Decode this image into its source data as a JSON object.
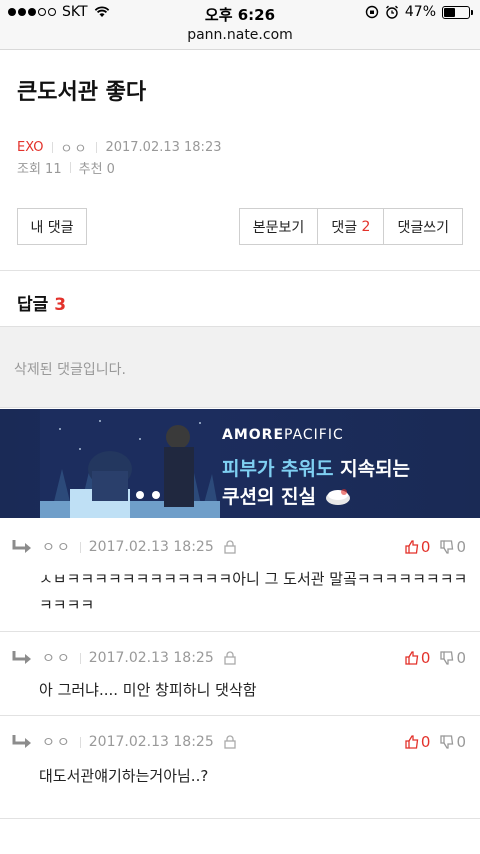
{
  "status": {
    "carrier": "SKT",
    "time": "오후 6:26",
    "battery": "47%",
    "battery_level": 0.47
  },
  "url": "pann.nate.com",
  "article": {
    "title": "큰도서관 좋다",
    "category": "EXO",
    "author": "ㅇㅇ",
    "datetime": "2017.02.13 18:23",
    "views": "조회 11",
    "recommend": "추천 0"
  },
  "buttons": {
    "my_comments": "내 댓글",
    "view_post": "본문보기",
    "comments_label": "댓글",
    "comments_count": "2",
    "write_comment": "댓글쓰기"
  },
  "replies": {
    "label": "답글",
    "count": "3",
    "deleted_text": "삭제된 댓글입니다."
  },
  "ad": {
    "brand_a": "AMORE",
    "brand_b": "PACIFIC",
    "line1_highlight": "피부가 추워도",
    "line1_rest": " 지속되는",
    "line2": "쿠션의 진실"
  },
  "comments": [
    {
      "nick": "ㅇㅇ",
      "date": "2017.02.13 18:25",
      "up": "0",
      "down": "0",
      "text": "ㅅㅂㅋㅋㅋㅋㅋㅋㅋㅋㅋㅋㅋㅋ아니 그 도서관 말곸ㅋㅋㅋㅋㅋㅋㅋㅋ ㅋㅋㅋㅋ"
    },
    {
      "nick": "ㅇㅇ",
      "date": "2017.02.13 18:25",
      "up": "0",
      "down": "0",
      "text": "아 그러냐.... 미안 창피하니 댓삭함"
    },
    {
      "nick": "ㅇㅇ",
      "date": "2017.02.13 18:25",
      "up": "0",
      "down": "0",
      "text": "대도서관얘기하는거아님..?"
    }
  ],
  "colors": {
    "accent": "#e3322b",
    "muted": "#999999",
    "ad_bg": "#1b2c5a",
    "ad_highlight": "#7fd0f2"
  }
}
